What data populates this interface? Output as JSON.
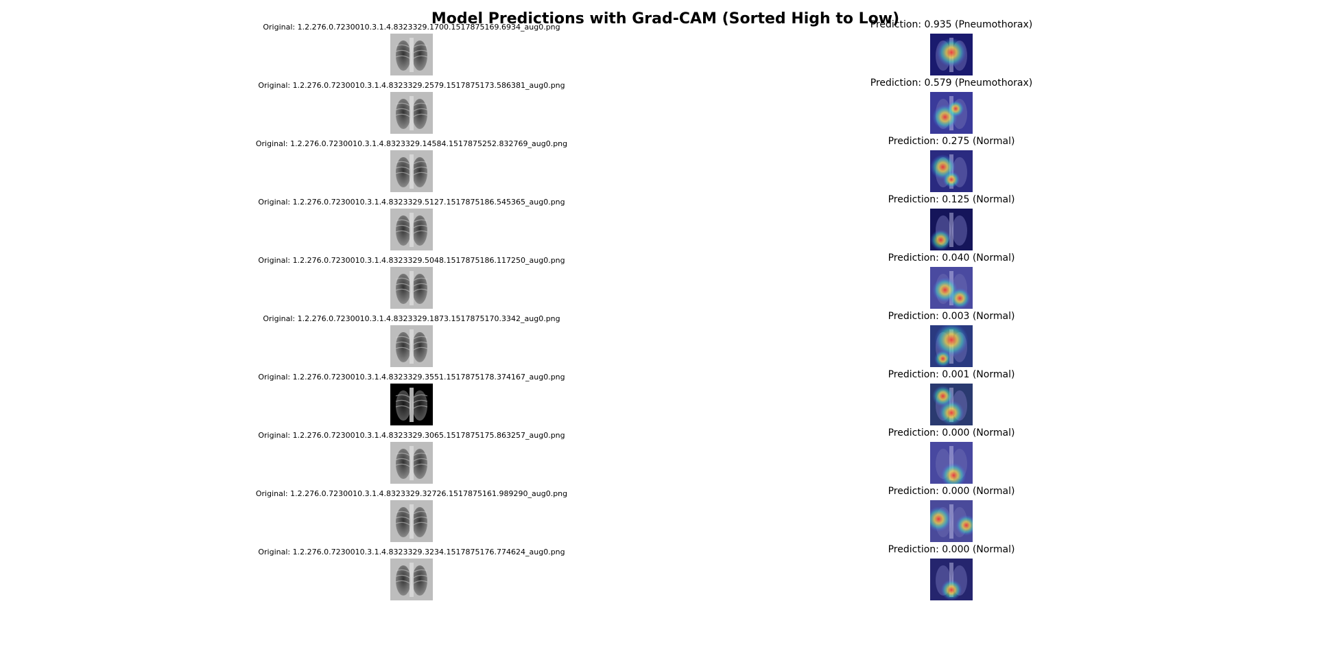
{
  "title": "Model Predictions with Grad-CAM (Sorted High to Low)",
  "rows": [
    {
      "original": "Original: 1.2.276.0.7230010.3.1.4.8323329.1700.1517875169.6934_aug0.png",
      "prediction": "Prediction: 0.935 (Pneumothorax)",
      "score": 0.935
    },
    {
      "original": "Original: 1.2.276.0.7230010.3.1.4.8323329.2579.1517875173.586381_aug0.png",
      "prediction": "Prediction: 0.579 (Pneumothorax)",
      "score": 0.579
    },
    {
      "original": "Original: 1.2.276.0.7230010.3.1.4.8323329.14584.1517875252.832769_aug0.png",
      "prediction": "Prediction: 0.275 (Normal)",
      "score": 0.275
    },
    {
      "original": "Original: 1.2.276.0.7230010.3.1.4.8323329.5127.1517875186.545365_aug0.png",
      "prediction": "Prediction: 0.125 (Normal)",
      "score": 0.125
    },
    {
      "original": "Original: 1.2.276.0.7230010.3.1.4.8323329.5048.1517875186.117250_aug0.png",
      "prediction": "Prediction: 0.040 (Normal)",
      "score": 0.04
    },
    {
      "original": "Original: 1.2.276.0.7230010.3.1.4.8323329.1873.1517875170.3342_aug0.png",
      "prediction": "Prediction: 0.003 (Normal)",
      "score": 0.003
    },
    {
      "original": "Original: 1.2.276.0.7230010.3.1.4.8323329.3551.1517875178.374167_aug0.png",
      "prediction": "Prediction: 0.001 (Normal)",
      "score": 0.001
    },
    {
      "original": "Original: 1.2.276.0.7230010.3.1.4.8323329.3065.1517875175.863257_aug0.png",
      "prediction": "Prediction: 0.000 (Normal)",
      "score": 0.0
    },
    {
      "original": "Original: 1.2.276.0.7230010.3.1.4.8323329.32726.1517875161.989290_aug0.png",
      "prediction": "Prediction: 0.000 (Normal)",
      "score": 0.0
    },
    {
      "original": "Original: 1.2.276.0.7230010.3.1.4.8323329.3234.1517875176.774624_aug0.png",
      "prediction": "Prediction: 0.000 (Normal)",
      "score": 0.0
    }
  ]
}
